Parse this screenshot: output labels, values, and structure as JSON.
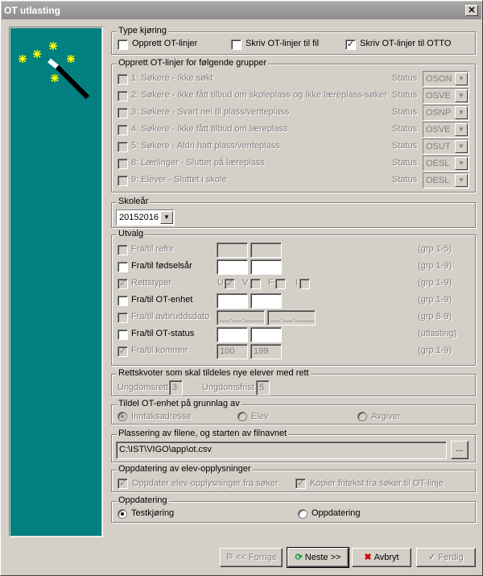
{
  "window": {
    "title": "OT utlasting"
  },
  "type_kjoring": {
    "title": "Type kjøring",
    "options": [
      {
        "label": "Opprett OT-linjer",
        "checked": false
      },
      {
        "label": "Skriv OT-linjer til fil",
        "checked": false
      },
      {
        "label": "Skriv OT-linjer til OTTO",
        "checked": true
      }
    ]
  },
  "grupper": {
    "title": "Opprett OT-linjer for følgende grupper",
    "status_label": "Status",
    "rows": [
      {
        "label": "1: Søkere - Ikke søkt",
        "status": "OSON"
      },
      {
        "label": "2: Søkere - Ikke fått tilbud om skoleplass og ikke læreplass-søker",
        "status": "OSVE"
      },
      {
        "label": "3: Søkere - Svart nei til plass/venteplass",
        "status": "OSNP"
      },
      {
        "label": "4: Søkere - Ikke fått tilbud om læreplass",
        "status": "OSVE"
      },
      {
        "label": "5: Søkere - Aldri hatt plass/venteplass",
        "status": "OSUT"
      },
      {
        "label": "8: Lærlinger - Sluttet på læreplass",
        "status": "OESL"
      },
      {
        "label": "9: Elever - Sluttet i skole",
        "status": "OESL"
      }
    ]
  },
  "skolear": {
    "title": "Skoleår",
    "value": "20152016"
  },
  "utvalg": {
    "title": "Utvalg",
    "rows": [
      {
        "label": "Fra/til refnr",
        "hint": "(grp 1-5)",
        "from": "",
        "to": ""
      },
      {
        "label": "Fra/til fødselsår",
        "hint": "(grp 1-9)",
        "from": "",
        "to": ""
      },
      {
        "label": "Rettstyper",
        "hint": "(grp 1-9)"
      },
      {
        "label": "Fra/til OT-enhet",
        "hint": "(grp 1-9)",
        "from": "",
        "to": ""
      },
      {
        "label": "Fra/til avbruddsdato",
        "hint": "(grp 8-9)",
        "from": "__.__.____",
        "to": "__.__.____"
      },
      {
        "label": "Fra/til OT-status",
        "hint": "(utlasting)",
        "from": "",
        "to": ""
      },
      {
        "label": "Fra/til kommnr",
        "hint": "(grp 1-9)",
        "from": "100",
        "to": "199"
      }
    ],
    "rett": {
      "u": "U",
      "v": "V",
      "f": "F",
      "i": "I"
    }
  },
  "rettskvoter": {
    "title": "Rettskvoter som skal tildeles nye elever med rett",
    "ungdomsrett_label": "Ungdomsrett",
    "ungdomsrett": "3",
    "ungdomsfrist_label": "Ungdomsfrist",
    "ungdomsfrist": "5"
  },
  "tildel": {
    "title": "Tildel OT-enhet på grunnlag av",
    "options": [
      "Inntaksadresse",
      "Elev",
      "Avgiver"
    ]
  },
  "plassering": {
    "title": "Plassering av filene, og starten av filnavnet",
    "path": "C:\\IST\\VIGO\\app\\ot.csv",
    "browse": "..."
  },
  "oppdatering_elev": {
    "title": "Oppdatering av elev-opplysninger",
    "opt1": "Oppdater elev-opplysninger fra søker",
    "opt2": "Kopier fritekst fra søker til OT-linje"
  },
  "oppdatering": {
    "title": "Oppdatering",
    "opt1": "Testkjøring",
    "opt2": "Oppdatering"
  },
  "buttons": {
    "back": "<< Forrige",
    "next": "Neste >>",
    "cancel": "Avbryt",
    "finish": "Ferdig"
  }
}
